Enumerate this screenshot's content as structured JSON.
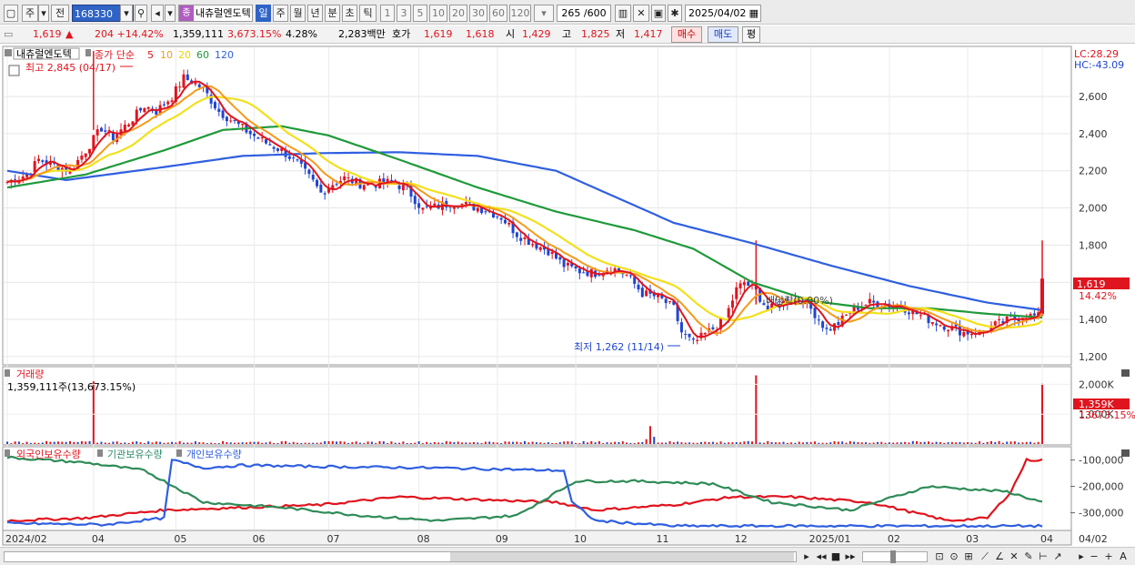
{
  "toolbar": {
    "type_label": "주",
    "before_label": "전",
    "stock_code": "168330",
    "stock_name": "내츄럴엔도텍",
    "name_badge": "종",
    "periods": [
      "일",
      "주",
      "월",
      "년",
      "분",
      "초",
      "틱"
    ],
    "selected_period": "일",
    "intervals": [
      "1",
      "3",
      "5",
      "10",
      "20",
      "30",
      "60",
      "120"
    ],
    "count_display": "265 /600",
    "date": "2025/04/02"
  },
  "quote": {
    "price": "1,619",
    "change": "204 +14.42%",
    "volume": "1,359,111",
    "volume_ratio": "3,673.15%",
    "turnover_pct": "4.28%",
    "amount": "2,283백만",
    "hoga_label": "호가",
    "ask": "1,619",
    "bid": "1,618",
    "open_label": "시",
    "open": "1,429",
    "high_label": "고",
    "high": "1,825",
    "low_label": "저",
    "low": "1,417",
    "buy_label": "매수",
    "sell_label": "매도",
    "eval_label": "평"
  },
  "colors": {
    "up": "#e0141e",
    "down": "#1f45d0",
    "ma5": "#e0141e",
    "ma10": "#f59a19",
    "ma20": "#f2e01c",
    "ma60": "#1f9a3a",
    "ma120": "#2f5fe0",
    "foreign": "#e0141e",
    "institution": "#3aa0a0",
    "individual": "#2f5fe0"
  },
  "chart_data": [
    {
      "type": "candlestick",
      "title": "내츄럴엔도텍",
      "legend_label": "종가 단순",
      "ma_periods": [
        "5",
        "10",
        "20",
        "60",
        "120"
      ],
      "ylim": [
        1160,
        2860
      ],
      "y_ticks": [
        "2,600",
        "2,400",
        "2,200",
        "2,000",
        "1,800",
        "1,600",
        "1,400",
        "1,200"
      ],
      "x_labels": [
        "2024/02",
        "04",
        "05",
        "06",
        "07",
        "08",
        "09",
        "10",
        "11",
        "12",
        "2025/01",
        "02",
        "03",
        "04",
        "04/02"
      ],
      "high_note": "최고 2,845 (04/17)",
      "low_note": "최저 1,262 (11/14)",
      "mid_note": "배당락(0.00%)",
      "lc_note": "LC:28.29",
      "hc_note": "HC:-43.09",
      "price_tag": "1,619",
      "price_tag_pct": "14.42%",
      "last_price": 1619,
      "close_path": [
        [
          0,
          2140
        ],
        [
          5,
          2180
        ],
        [
          8,
          2260
        ],
        [
          12,
          2230
        ],
        [
          16,
          2200
        ],
        [
          20,
          2310
        ],
        [
          24,
          2430
        ],
        [
          27,
          2380
        ],
        [
          31,
          2460
        ],
        [
          35,
          2550
        ],
        [
          38,
          2520
        ],
        [
          42,
          2600
        ],
        [
          45,
          2700
        ],
        [
          48,
          2670
        ],
        [
          50,
          2640
        ],
        [
          54,
          2520
        ],
        [
          58,
          2460
        ],
        [
          62,
          2400
        ],
        [
          66,
          2350
        ],
        [
          70,
          2310
        ],
        [
          74,
          2240
        ],
        [
          78,
          2140
        ],
        [
          80,
          2080
        ],
        [
          83,
          2130
        ],
        [
          86,
          2160
        ],
        [
          90,
          2130
        ],
        [
          94,
          2130
        ],
        [
          98,
          2140
        ],
        [
          102,
          2100
        ],
        [
          106,
          1990
        ],
        [
          110,
          2010
        ],
        [
          114,
          2030
        ],
        [
          118,
          2010
        ],
        [
          122,
          1990
        ],
        [
          126,
          1950
        ],
        [
          130,
          1860
        ],
        [
          134,
          1810
        ],
        [
          138,
          1770
        ],
        [
          142,
          1690
        ],
        [
          146,
          1660
        ],
        [
          150,
          1650
        ],
        [
          154,
          1680
        ],
        [
          158,
          1640
        ],
        [
          162,
          1540
        ],
        [
          166,
          1520
        ],
        [
          170,
          1460
        ],
        [
          172,
          1330
        ],
        [
          175,
          1270
        ],
        [
          178,
          1320
        ],
        [
          180,
          1350
        ],
        [
          183,
          1400
        ],
        [
          186,
          1560
        ],
        [
          188,
          1600
        ],
        [
          191,
          1550
        ],
        [
          194,
          1450
        ],
        [
          197,
          1480
        ],
        [
          200,
          1510
        ],
        [
          203,
          1510
        ],
        [
          206,
          1430
        ],
        [
          209,
          1340
        ],
        [
          212,
          1380
        ],
        [
          216,
          1460
        ],
        [
          220,
          1490
        ],
        [
          224,
          1480
        ],
        [
          228,
          1470
        ],
        [
          232,
          1430
        ],
        [
          236,
          1390
        ],
        [
          240,
          1360
        ],
        [
          244,
          1330
        ],
        [
          248,
          1330
        ],
        [
          252,
          1370
        ],
        [
          256,
          1400
        ],
        [
          260,
          1420
        ],
        [
          263,
          1415
        ],
        [
          264,
          1619
        ]
      ],
      "ma60_path": [
        [
          0,
          2110
        ],
        [
          20,
          2180
        ],
        [
          40,
          2310
        ],
        [
          55,
          2420
        ],
        [
          70,
          2440
        ],
        [
          82,
          2390
        ],
        [
          100,
          2260
        ],
        [
          120,
          2110
        ],
        [
          140,
          1980
        ],
        [
          160,
          1880
        ],
        [
          175,
          1780
        ],
        [
          190,
          1600
        ],
        [
          205,
          1500
        ],
        [
          220,
          1460
        ],
        [
          235,
          1460
        ],
        [
          250,
          1430
        ],
        [
          264,
          1410
        ]
      ],
      "ma120_path": [
        [
          0,
          2200
        ],
        [
          15,
          2150
        ],
        [
          40,
          2220
        ],
        [
          60,
          2280
        ],
        [
          80,
          2295
        ],
        [
          100,
          2300
        ],
        [
          120,
          2280
        ],
        [
          140,
          2200
        ],
        [
          155,
          2060
        ],
        [
          170,
          1920
        ],
        [
          190,
          1810
        ],
        [
          210,
          1690
        ],
        [
          230,
          1580
        ],
        [
          250,
          1490
        ],
        [
          264,
          1450
        ]
      ]
    },
    {
      "type": "bar",
      "title": "거래량",
      "volume_label": "1,359,111주(13,673.15%)",
      "y_ticks": [
        "2,000K",
        "1,000K"
      ],
      "tag_value": "1,359K",
      "tag_pct": "13673.15%",
      "ylim": [
        0,
        2500
      ],
      "spikes": [
        [
          22,
          2100
        ],
        [
          164,
          600
        ],
        [
          165,
          240
        ],
        [
          163,
          160
        ],
        [
          191,
          2300
        ],
        [
          264,
          2020
        ]
      ],
      "baseline": 70
    },
    {
      "type": "line",
      "title": "외국인보유수량",
      "series": [
        {
          "name": "외국인보유수량",
          "points": [
            [
              0,
              -330000
            ],
            [
              20,
              -320000
            ],
            [
              40,
              -290000
            ],
            [
              60,
              -280000
            ],
            [
              80,
              -270000
            ],
            [
              100,
              -240000
            ],
            [
              120,
              -250000
            ],
            [
              140,
              -260000
            ],
            [
              150,
              -290000
            ],
            [
              170,
              -270000
            ],
            [
              185,
              -240000
            ],
            [
              200,
              -240000
            ],
            [
              220,
              -260000
            ],
            [
              240,
              -330000
            ],
            [
              250,
              -320000
            ],
            [
              256,
              -220000
            ],
            [
              260,
              -100000
            ],
            [
              264,
              -100000
            ]
          ]
        },
        {
          "name": "기관보유수량",
          "points": [
            [
              0,
              -90000
            ],
            [
              20,
              -110000
            ],
            [
              35,
              -140000
            ],
            [
              50,
              -260000
            ],
            [
              70,
              -280000
            ],
            [
              90,
              -310000
            ],
            [
              110,
              -330000
            ],
            [
              130,
              -310000
            ],
            [
              145,
              -180000
            ],
            [
              160,
              -180000
            ],
            [
              180,
              -190000
            ],
            [
              195,
              -260000
            ],
            [
              215,
              -290000
            ],
            [
              235,
              -200000
            ],
            [
              255,
              -220000
            ],
            [
              264,
              -260000
            ]
          ]
        },
        {
          "name": "개인보유수량",
          "points": [
            [
              0,
              -340000
            ],
            [
              25,
              -345000
            ],
            [
              40,
              -320000
            ],
            [
              42,
              -100000
            ],
            [
              50,
              -130000
            ],
            [
              60,
              -120000
            ],
            [
              80,
              -125000
            ],
            [
              110,
              -130000
            ],
            [
              142,
              -140000
            ],
            [
              144,
              -260000
            ],
            [
              150,
              -330000
            ],
            [
              170,
              -350000
            ],
            [
              264,
              -350000
            ]
          ]
        }
      ],
      "y_ticks": [
        "-100,000",
        "-200,000",
        "-300,000"
      ],
      "ylim": [
        -360000,
        -60000
      ]
    }
  ]
}
